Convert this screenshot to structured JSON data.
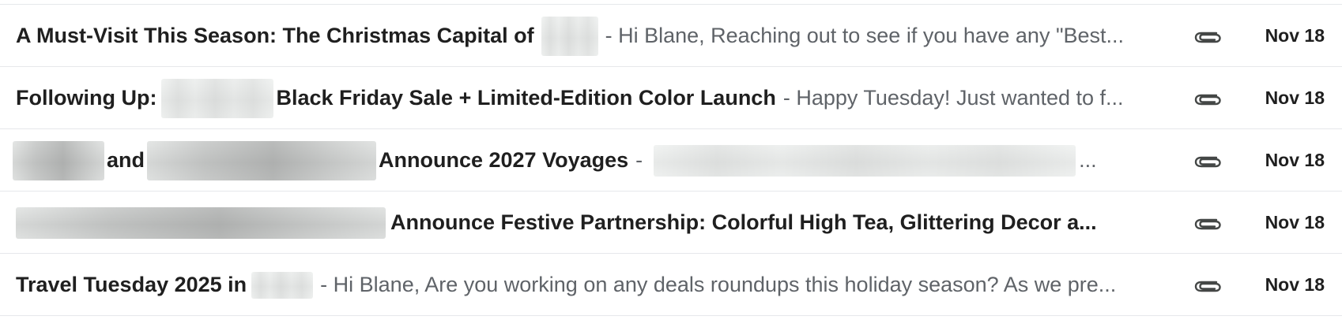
{
  "emails": [
    {
      "subject_before": "A Must-Visit This Season: The Christmas Capital of",
      "subject_after": "",
      "snippet": "- Hi Blane, Reaching out to see if you have any \"Best...",
      "date": "Nov 18",
      "icon": "paperclip-icon"
    },
    {
      "subject_before": "Following Up:",
      "subject_after": "Black Friday Sale + Limited-Edition Color Launch",
      "snippet": "- Happy Tuesday! Just wanted to f...",
      "date": "Nov 18",
      "icon": "paperclip-icon"
    },
    {
      "subject_and": "and",
      "subject_after": "Announce 2027 Voyages",
      "snippet_dash": "-",
      "snippet_ellipsis": "...",
      "date": "Nov 18",
      "icon": "paperclip-icon"
    },
    {
      "subject_after": "Announce Festive Partnership: Colorful High Tea, Glittering Decor a...",
      "date": "Nov 18",
      "icon": "paperclip-icon"
    },
    {
      "subject_before": "Travel Tuesday 2025 in",
      "snippet": "- Hi Blane, Are you working on any deals roundups this holiday season? As we pre...",
      "date": "Nov 18",
      "icon": "paperclip-icon"
    }
  ]
}
